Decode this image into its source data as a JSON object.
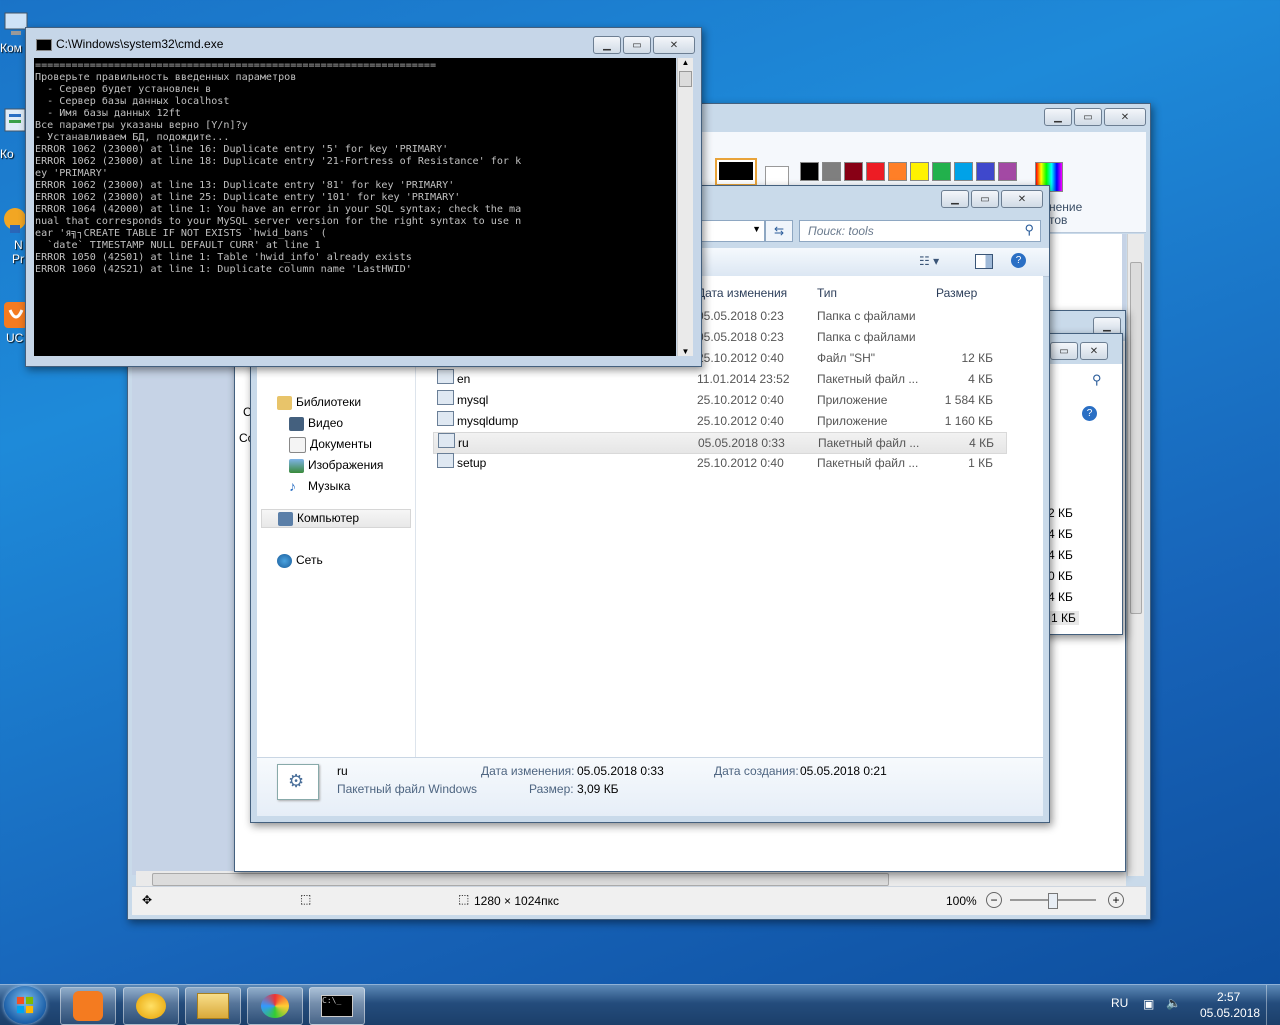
{
  "desktop": {
    "icons": [
      {
        "label": "Ком",
        "icon": "computer-icon"
      },
      {
        "label": "Ко",
        "icon": "control-panel-icon"
      },
      {
        "label": "N",
        "icon": "app-icon"
      },
      {
        "label": "Pr",
        "icon": "app-icon"
      },
      {
        "label": "UC",
        "icon": "uc-browser-icon"
      }
    ]
  },
  "cmd": {
    "title": "C:\\Windows\\system32\\cmd.exe",
    "output": "==================================================================\nПроверьте правильность введенных параметров\n  - Сервер будет установлен в\n  - Сервер базы данных localhost\n  - Имя базы данных 12ft\nВсе параметры указаны верно [Y/n]?y\n- Устанавливаем БД, подождите...\nERROR 1062 (23000) at line 16: Duplicate entry '5' for key 'PRIMARY'\nERROR 1062 (23000) at line 18: Duplicate entry '21-Fortress of Resistance' for k\ney 'PRIMARY'\nERROR 1062 (23000) at line 13: Duplicate entry '81' for key 'PRIMARY'\nERROR 1062 (23000) at line 25: Duplicate entry '101' for key 'PRIMARY'\nERROR 1064 (42000) at line 1: You have an error in your SQL syntax; check the ma\nnual that corresponds to your MySQL server version for the right syntax to use n\near 'я╗┐CREATE TABLE IF NOT EXISTS `hwid_bans` (\n  `date` TIMESTAMP NULL DEFAULT CURR' at line 1\nERROR 1050 (42S01) at line 1: Table 'hwid_info' already exists\nERROR 1060 (42S21) at line 1: Duplicate column name 'LastHWID'"
  },
  "paint": {
    "ribbon_partial_label_1": "нение",
    "ribbon_partial_label_2": "тов",
    "status_size": "1280 × 1024пкс",
    "zoom": "100%",
    "colors": [
      "#000000",
      "#7f7f7f",
      "#880015",
      "#ed1c24",
      "#ff7f27",
      "#fff200",
      "#22b14c",
      "#00a2e8",
      "#3f48cc",
      "#a349a4"
    ]
  },
  "background_window": {
    "partial_sizes": [
      "2 КБ",
      "4 КБ",
      "4 КБ",
      "0 КБ",
      "4 КБ",
      "1 КБ"
    ],
    "partial_left_1": "С",
    "partial_left_2": "Co"
  },
  "explorer": {
    "search_placeholder": "Поиск: tools",
    "columns": {
      "date": "Дата изменения",
      "type": "Тип",
      "size": "Размер"
    },
    "nav": {
      "libraries": "Библиотеки",
      "video": "Видео",
      "documents": "Документы",
      "images": "Изображения",
      "music": "Музыка",
      "computer": "Компьютер",
      "network": "Сеть"
    },
    "rows": [
      {
        "name": "",
        "date": "05.05.2018 0:23",
        "type": "Папка с файлами",
        "size": ""
      },
      {
        "name": "",
        "date": "05.05.2018 0:23",
        "type": "Папка с файлами",
        "size": ""
      },
      {
        "name": "",
        "date": "25.10.2012 0:40",
        "type": "Файл \"SH\"",
        "size": "12 КБ"
      },
      {
        "name": "en",
        "date": "11.01.2014 23:52",
        "type": "Пакетный файл ...",
        "size": "4 КБ"
      },
      {
        "name": "mysql",
        "date": "25.10.2012 0:40",
        "type": "Приложение",
        "size": "1 584 КБ"
      },
      {
        "name": "mysqldump",
        "date": "25.10.2012 0:40",
        "type": "Приложение",
        "size": "1 160 КБ"
      },
      {
        "name": "ru",
        "date": "05.05.2018 0:33",
        "type": "Пакетный файл ...",
        "size": "4 КБ"
      },
      {
        "name": "setup",
        "date": "25.10.2012 0:40",
        "type": "Пакетный файл ...",
        "size": "1 КБ"
      }
    ],
    "details": {
      "name": "ru",
      "kind": "Пакетный файл Windows",
      "modified_label": "Дата изменения:",
      "modified_value": "05.05.2018 0:33",
      "created_label": "Дата создания:",
      "created_value": "05.05.2018 0:21",
      "size_label": "Размер:",
      "size_value": "3,09 КБ"
    }
  },
  "taskbar": {
    "lang": "RU",
    "time": "2:57",
    "date": "05.05.2018"
  }
}
